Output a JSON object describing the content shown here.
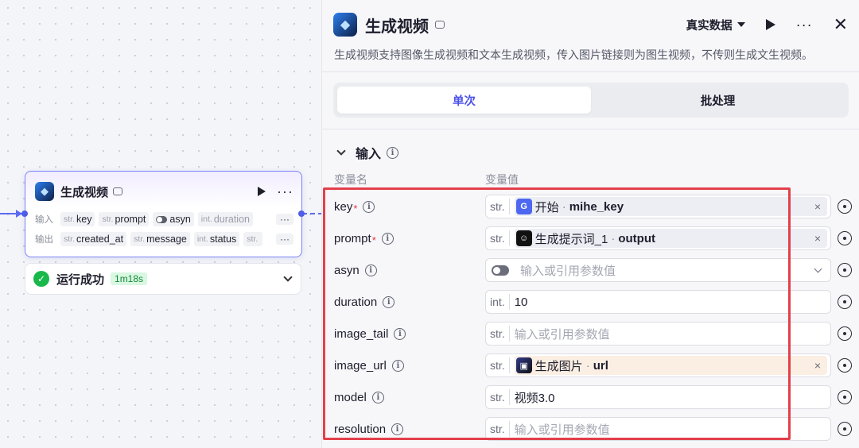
{
  "node": {
    "title": "生成视频",
    "inputs_label": "输入",
    "outputs_label": "输出",
    "inputs": [
      {
        "type": "str.",
        "name": "key"
      },
      {
        "type": "str.",
        "name": "prompt"
      },
      {
        "type": "toggle",
        "name": "asyn"
      },
      {
        "type": "int.",
        "name": "duration"
      }
    ],
    "outputs": [
      {
        "type": "str.",
        "name": "created_at"
      },
      {
        "type": "str.",
        "name": "message"
      },
      {
        "type": "int.",
        "name": "status"
      },
      {
        "type": "str.",
        "name": ""
      }
    ],
    "more": "···",
    "run_status": "运行成功",
    "run_time": "1m18s"
  },
  "panel": {
    "title": "生成视频",
    "data_select": "真实数据",
    "description": "生成视频支持图像生成视频和文本生成视频，传入图片链接则为图生视频，不传则生成文生视频。",
    "tabs": [
      "单次",
      "批处理"
    ],
    "section": "输入",
    "col_name": "变量名",
    "col_value": "变量值",
    "params": [
      {
        "name": "key",
        "required": true,
        "type": "str.",
        "kind": "ref",
        "src": "开始",
        "var": "mihe_key",
        "icon": "blue"
      },
      {
        "name": "prompt",
        "required": true,
        "type": "str.",
        "kind": "ref",
        "src": "生成提示词_1",
        "var": "output",
        "icon": "black"
      },
      {
        "name": "asyn",
        "required": false,
        "type": "toggle",
        "kind": "select",
        "placeholder": "输入或引用参数值"
      },
      {
        "name": "duration",
        "required": false,
        "type": "int.",
        "kind": "value",
        "value": "10"
      },
      {
        "name": "image_tail",
        "required": false,
        "type": "str.",
        "kind": "placeholder",
        "placeholder": "输入或引用参数值"
      },
      {
        "name": "image_url",
        "required": false,
        "type": "str.",
        "kind": "ref",
        "src": "生成图片",
        "var": "url",
        "icon": "img",
        "highlight": "orange"
      },
      {
        "name": "model",
        "required": false,
        "type": "str.",
        "kind": "value",
        "value": "视频3.0"
      },
      {
        "name": "resolution",
        "required": false,
        "type": "str.",
        "kind": "placeholder",
        "placeholder": "输入或引用参数值"
      }
    ]
  },
  "colors": {
    "accent": "#4d53e8",
    "success": "#19b84b",
    "highlight_border": "#e2404b"
  }
}
